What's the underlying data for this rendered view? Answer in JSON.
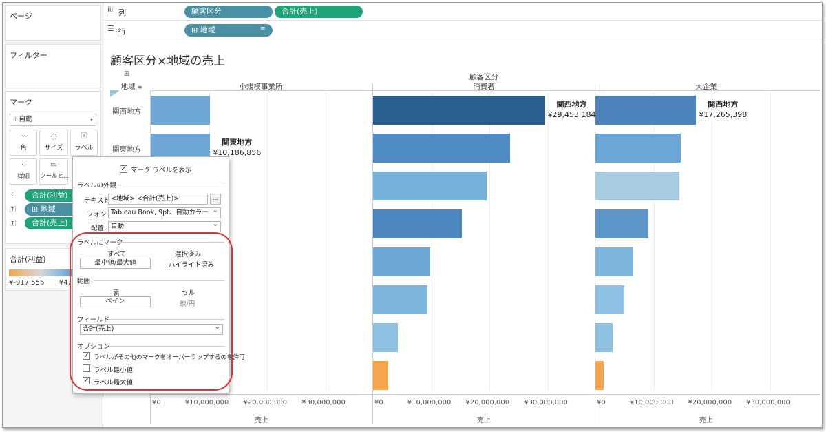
{
  "sidebar": {
    "pages_title": "ページ",
    "filters_title": "フィルター",
    "marks_title": "マーク",
    "mark_type": "自動",
    "mark_buttons": [
      "色",
      "サイズ",
      "ラベル",
      "詳細",
      "ツールヒ..."
    ],
    "mark_fields": [
      "合計(利益)",
      "⊞ 地域",
      "合計(売上)"
    ],
    "legend_title": "合計(利益)",
    "legend_min": "¥-917,556",
    "legend_max_partial": "¥4,"
  },
  "shelves": {
    "columns_label": "列",
    "rows_label": "行",
    "column_pills": [
      "顧客区分",
      "合計(売上)"
    ],
    "row_pills": [
      "⊞ 地域"
    ]
  },
  "view": {
    "title": "顧客区分×地域の売上",
    "header_top": "顧客区分",
    "row_header": "地域",
    "segments": [
      "小規模事業所",
      "消費者",
      "大企業"
    ],
    "row_labels": [
      "関西地方",
      "関東地方"
    ],
    "axis_ticks": [
      "¥0",
      "¥10,000,000",
      "¥20,000,000",
      "¥30,000,000"
    ],
    "axis_title": "売上"
  },
  "chart_data": {
    "type": "bar",
    "orientation": "horizontal",
    "x_axis_label": "売上",
    "xlim": [
      0,
      38000000
    ],
    "panels": [
      {
        "segment": "小規模事業所",
        "bars": [
          {
            "region": "関西地方",
            "value": 10186856,
            "color": "#6fa8d6"
          },
          {
            "region": "関東地方",
            "value": 10186856,
            "color": "#6fa8d6",
            "label": true
          }
        ]
      },
      {
        "segment": "消費者",
        "bars": [
          {
            "region": "関西地方",
            "value": 29453184,
            "color": "#2b5f8f",
            "label": true
          },
          {
            "region": "",
            "value": 23500000,
            "color": "#4e8bc2"
          },
          {
            "region": "",
            "value": 19500000,
            "color": "#77b2db"
          },
          {
            "region": "",
            "value": 15200000,
            "color": "#4b86be"
          },
          {
            "region": "",
            "value": 9800000,
            "color": "#6ea8d6"
          },
          {
            "region": "",
            "value": 9300000,
            "color": "#7db5dd"
          },
          {
            "region": "",
            "value": 4300000,
            "color": "#8ec0e2"
          },
          {
            "region": "",
            "value": 2600000,
            "color": "#f5a54b"
          }
        ]
      },
      {
        "segment": "大企業",
        "bars": [
          {
            "region": "関西地方",
            "value": 17265398,
            "color": "#4c83ba",
            "label": true
          },
          {
            "region": "",
            "value": 14600000,
            "color": "#6aa6d6"
          },
          {
            "region": "",
            "value": 14400000,
            "color": "#a7cbe0"
          },
          {
            "region": "",
            "value": 9100000,
            "color": "#5e98cb"
          },
          {
            "region": "",
            "value": 6500000,
            "color": "#7db5dd"
          },
          {
            "region": "",
            "value": 5000000,
            "color": "#8fc1e4"
          },
          {
            "region": "",
            "value": 2900000,
            "color": "#8ec0e2"
          },
          {
            "region": "",
            "value": 1400000,
            "color": "#f5a54b"
          }
        ]
      }
    ],
    "labels": [
      {
        "panel": 0,
        "row": 1,
        "region": "関東地方",
        "value_text": "¥10,186,856"
      },
      {
        "panel": 1,
        "row": 0,
        "region": "関西地方",
        "value_text": "¥29,453,184"
      },
      {
        "panel": 2,
        "row": 0,
        "region": "関西地方",
        "value_text": "¥17,265,398"
      }
    ]
  },
  "dialog": {
    "show_labels": "マーク ラベルを表示",
    "appearance_title": "ラベルの外観",
    "text_label": "テキスト:",
    "text_value": "<地域> <合計(売上)>",
    "font_label": "フォント:",
    "font_value": "Tableau Book, 9pt、自動カラー",
    "align_label": "配置:",
    "align_value": "自動",
    "marks_to_label_title": "ラベルにマーク",
    "opt_all": "すべて",
    "opt_selected": "選択済み",
    "opt_minmax": "最小値/最大値",
    "opt_highlighted": "ハイライト済み",
    "scope_title": "範囲",
    "opt_table": "表",
    "opt_cell": "セル",
    "opt_pane": "ペイン",
    "opt_line": "線/円",
    "field_title": "フィールド",
    "field_value": "合計(売上)",
    "options_title": "オプション",
    "allow_overlap": "ラベルがその他のマークをオーバーラップするのを許可",
    "label_min": "ラベル最小値",
    "label_max": "ラベル最大値"
  }
}
